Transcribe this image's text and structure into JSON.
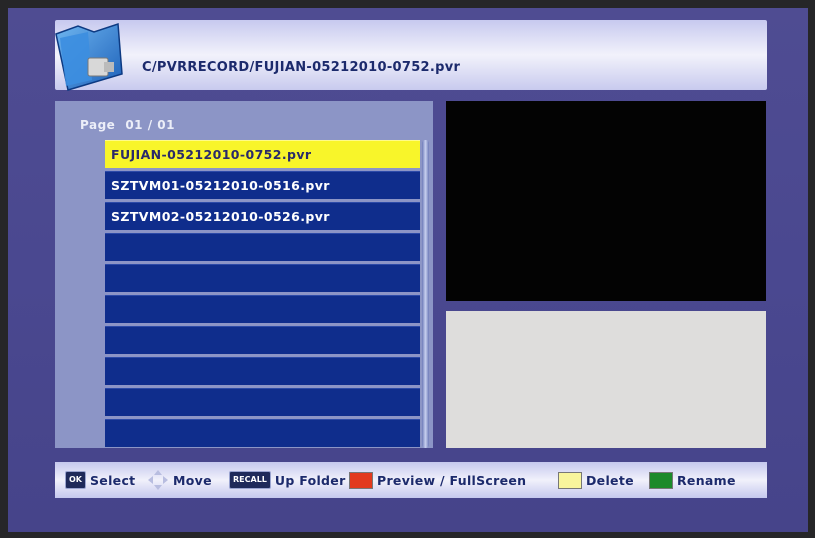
{
  "header": {
    "path": "C/PVRRECORD/FUJIAN-05212010-0752.pvr"
  },
  "list": {
    "page_label": "Page",
    "page_number": "01 / 01",
    "items": [
      {
        "label": "FUJIAN-05212010-0752.pvr",
        "selected": true
      },
      {
        "label": "SZTVM01-05212010-0516.pvr",
        "selected": false
      },
      {
        "label": "SZTVM02-05212010-0526.pvr",
        "selected": false
      },
      {
        "label": "",
        "selected": false
      },
      {
        "label": "",
        "selected": false
      },
      {
        "label": "",
        "selected": false
      },
      {
        "label": "",
        "selected": false
      },
      {
        "label": "",
        "selected": false
      },
      {
        "label": "",
        "selected": false
      },
      {
        "label": "",
        "selected": false
      }
    ]
  },
  "footer": {
    "ok_key": "OK",
    "select": "Select",
    "move": "Move",
    "recall_key": "RECALL",
    "up_folder": "Up Folder",
    "preview": "Preview / FullScreen",
    "delete": "Delete",
    "rename": "Rename"
  },
  "colors": {
    "red_key": "#e23a1e",
    "yellow_key": "#f8f59c",
    "green_key": "#1c8a2a"
  }
}
